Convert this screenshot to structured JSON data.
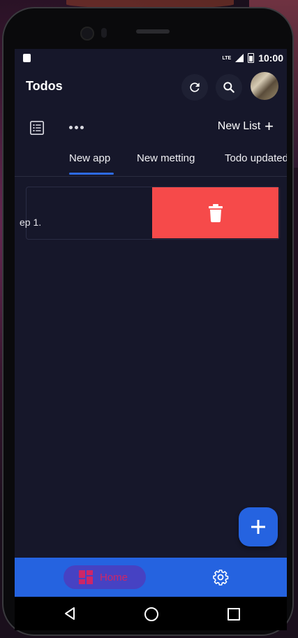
{
  "status_bar": {
    "network": "LTE",
    "time": "10:00"
  },
  "appbar": {
    "title": "Todos"
  },
  "toolbar": {
    "new_list_label": "New List"
  },
  "tabs": [
    {
      "label": "New app",
      "selected": true
    },
    {
      "label": "New metting",
      "selected": false
    },
    {
      "label": "Todo updated",
      "selected": false
    }
  ],
  "todo_card": {
    "text": "ep 1."
  },
  "bottom_nav": {
    "home_label": "Home"
  },
  "colors": {
    "background": "#16172a",
    "accent": "#2563e0",
    "delete": "#f64a4a",
    "home_label": "#e0205a"
  }
}
